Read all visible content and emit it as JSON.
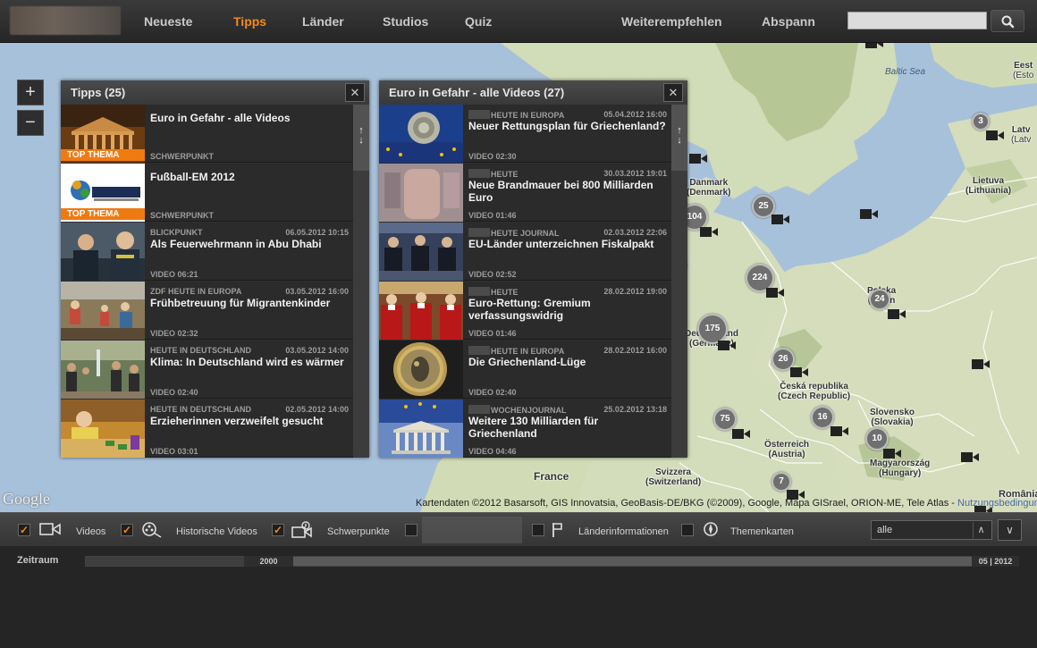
{
  "nav": {
    "items": [
      "Neueste",
      "Tipps",
      "Länder",
      "Studios",
      "Quiz"
    ],
    "right_items": [
      "Weiterempfehlen",
      "Abspann"
    ],
    "active": "Tipps",
    "accent_color": "#f28a1c"
  },
  "search": {
    "placeholder": "",
    "value": "",
    "icon": "search-icon"
  },
  "map": {
    "zoom_in": "+",
    "zoom_out": "−",
    "places": [
      "Baltic Sea",
      "Eest",
      "(Esto",
      "Latv",
      "(Latv",
      "Lietuva",
      "(Lithuania)",
      "Polska",
      "(Polan",
      "Česká republika",
      "(Czech Republic)",
      "Slovensko",
      "(Slovakia)",
      "Österreich",
      "(Austria)",
      "Magyarország",
      "(Hungary)",
      "Svizzera",
      "(Switzerland)",
      "France",
      "România",
      "Danmark",
      "(Denmark)",
      "Deutschland",
      "(Germany)"
    ],
    "clusters": [
      "3",
      "104",
      "25",
      "224",
      "24",
      "175",
      "26",
      "75",
      "16",
      "10",
      "7"
    ],
    "google_logo": "Google",
    "attribution": "Kartendaten ©2012 Basarsoft, GIS Innovatsia, GeoBasis-DE/BKG (©2009), Google, Mapa GISrael, ORION-ME, Tele Atlas -",
    "attribution_link": "Nutzungsbedingungen"
  },
  "tipps_panel": {
    "title": "Tipps (25)",
    "close": "✕",
    "items": [
      {
        "title": "Euro in Gefahr - alle Videos",
        "source": "",
        "date": "",
        "footer": "SCHWERPUNKT",
        "badge": "TOP THEMA"
      },
      {
        "title": "Fußball-EM 2012",
        "source": "",
        "date": "",
        "footer": "SCHWERPUNKT",
        "badge": "TOP THEMA"
      },
      {
        "title": "Als Feuerwehrmann in Abu Dhabi",
        "source": "BLICKPUNKT",
        "date": "06.05.2012 10:15",
        "footer": "VIDEO 06:21",
        "badge": ""
      },
      {
        "title": "Frühbetreuung für Migrantenkinder",
        "source": "ZDF HEUTE IN EUROPA",
        "date": "03.05.2012 16:00",
        "footer": "VIDEO 02:32",
        "badge": ""
      },
      {
        "title": "Klima: In Deutschland wird es wärmer",
        "source": "HEUTE IN DEUTSCHLAND",
        "date": "03.05.2012 14:00",
        "footer": "VIDEO 02:40",
        "badge": ""
      },
      {
        "title": "Erzieherinnen verzweifelt gesucht",
        "source": "HEUTE IN DEUTSCHLAND",
        "date": "02.05.2012 14:00",
        "footer": "VIDEO 03:01",
        "badge": ""
      }
    ]
  },
  "euro_panel": {
    "title": "Euro in Gefahr - alle Videos (27)",
    "close": "✕",
    "items": [
      {
        "title": "Neuer Rettungsplan für Griechenland?",
        "source": "HEUTE IN EUROPA",
        "date": "05.04.2012 16:00",
        "footer": "VIDEO 02:30"
      },
      {
        "title": "Neue Brandmauer bei 800 Milliarden Euro",
        "source": "HEUTE",
        "date": "30.03.2012 19:01",
        "footer": "VIDEO 01:46"
      },
      {
        "title": "EU-Länder unterzeichnen Fiskalpakt",
        "source": "HEUTE JOURNAL",
        "date": "02.03.2012 22:06",
        "footer": "VIDEO 02:52"
      },
      {
        "title": "Euro-Rettung: Gremium verfassungswidrig",
        "source": "HEUTE",
        "date": "28.02.2012 19:00",
        "footer": "VIDEO 01:46"
      },
      {
        "title": "Die Griechenland-Lüge",
        "source": "HEUTE IN EUROPA",
        "date": "28.02.2012 16:00",
        "footer": "VIDEO 02:40"
      },
      {
        "title": "Weitere 130 Milliarden für Griechenland",
        "source": "WOCHENJOURNAL",
        "date": "25.02.2012 13:18",
        "footer": "VIDEO 04:46"
      }
    ]
  },
  "filters": {
    "videos": {
      "label": "Videos",
      "checked": true
    },
    "historic": {
      "label": "Historische Videos",
      "checked": true
    },
    "focus": {
      "label": "Schwerpunkte",
      "checked": true
    },
    "hidden": {
      "checked": false
    },
    "countries": {
      "label": "Länderinformationen",
      "checked": false
    },
    "themes": {
      "label": "Themenkarten",
      "checked": false
    },
    "check_mark": "✓",
    "select_value": "alle",
    "select_up": "∧",
    "expand": "∨"
  },
  "timeline": {
    "label": "Zeitraum",
    "start": "2000",
    "end": "05 | 2012"
  },
  "colors": {
    "accent": "#f28a1c",
    "badge": "#f07a12",
    "water": "#aac2d9",
    "land": "#d3dcbb",
    "forest": "#aebf8f"
  }
}
